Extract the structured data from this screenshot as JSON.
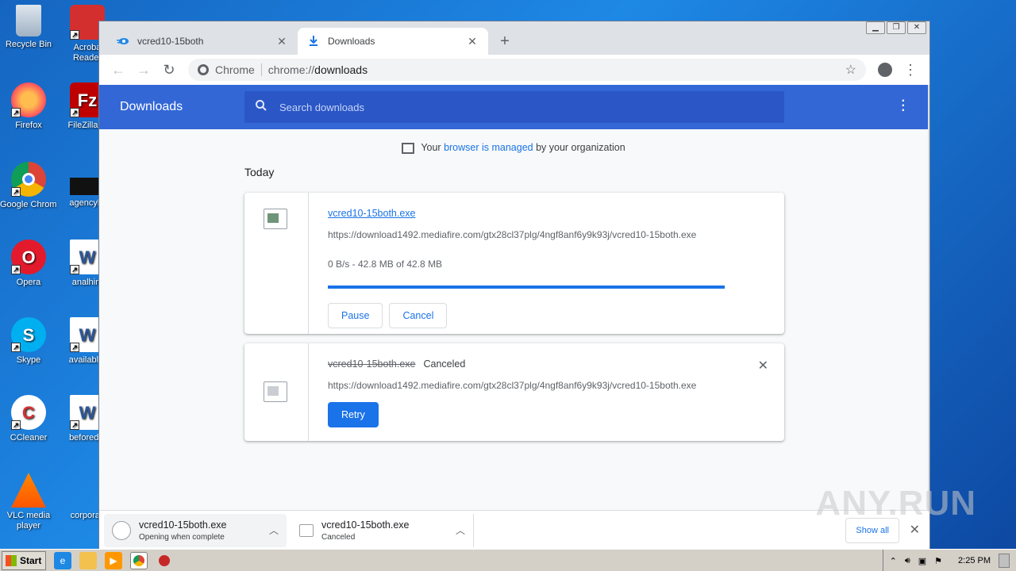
{
  "desktop": {
    "icons": [
      {
        "label": "Recycle Bin"
      },
      {
        "label": "Acroba Reader"
      },
      {
        "label": "Firefox"
      },
      {
        "label": "FileZilla C"
      },
      {
        "label": "Google Chrome"
      },
      {
        "label": "agencybr"
      },
      {
        "label": "Opera"
      },
      {
        "label": "analhim"
      },
      {
        "label": "Skype"
      },
      {
        "label": "availablet"
      },
      {
        "label": "CCleaner"
      },
      {
        "label": "beforedoi"
      },
      {
        "label": "VLC media player"
      },
      {
        "label": "corporati"
      }
    ]
  },
  "browser": {
    "tabs": [
      {
        "title": "vcred10-15both",
        "close": "✕"
      },
      {
        "title": "Downloads",
        "close": "✕"
      }
    ],
    "new_tab": "+",
    "omnibox": {
      "site_label": "Chrome",
      "url_scheme": "chrome://",
      "url_host": "downloads"
    }
  },
  "downloads_page": {
    "title": "Downloads",
    "search_placeholder": "Search downloads",
    "managed_prefix": "Your ",
    "managed_link": "browser is managed",
    "managed_suffix": " by your organization",
    "section": "Today",
    "items": [
      {
        "filename": "vcred10-15both.exe",
        "url": "https://download1492.mediafire.com/gtx28cl37plg/4ngf8anf6y9k93j/vcred10-15both.exe",
        "progress_text": "0 B/s - 42.8 MB of 42.8 MB",
        "progress": 1.0,
        "buttons": [
          "Pause",
          "Cancel"
        ]
      },
      {
        "filename": "vcred10-15both.exe",
        "status": "Canceled",
        "url": "https://download1492.mediafire.com/gtx28cl37plg/4ngf8anf6y9k93j/vcred10-15both.exe",
        "buttons": [
          "Retry"
        ]
      }
    ]
  },
  "shelf": {
    "items": [
      {
        "name": "vcred10-15both.exe",
        "sub": "Opening when complete"
      },
      {
        "name": "vcred10-15both.exe",
        "sub": "Canceled"
      }
    ],
    "show_all": "Show all"
  },
  "watermark": "ANY.RUN",
  "taskbar": {
    "start": "Start",
    "clock": "2:25 PM"
  },
  "colors": {
    "accent": "#1a73e8",
    "header": "#3367d6"
  }
}
